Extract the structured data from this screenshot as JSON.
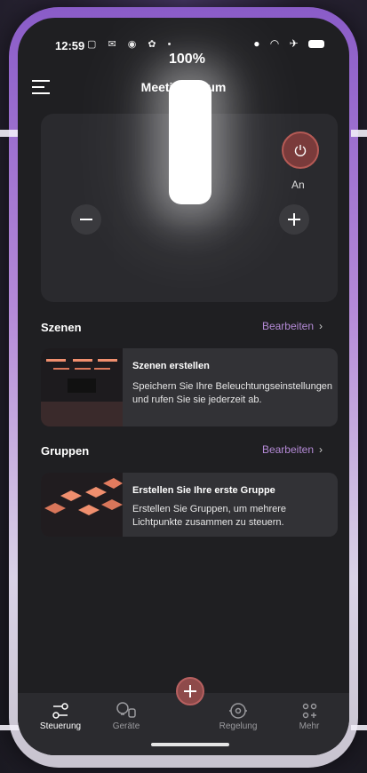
{
  "status_bar": {
    "time": "12:59"
  },
  "header": {
    "title": "Meeting Raum",
    "menu_icon": "menu-icon"
  },
  "control": {
    "brightness": "100%",
    "brightness_value": 100,
    "power_state": "An",
    "accent": "#b55a55"
  },
  "scenes": {
    "title": "Szenen",
    "edit_label": "Bearbeiten",
    "card": {
      "title": "Szenen erstellen",
      "description": "Speichern Sie Ihre Beleuchtungseinstellungen und rufen Sie sie jederzeit ab."
    }
  },
  "groups": {
    "title": "Gruppen",
    "edit_label": "Bearbeiten",
    "card": {
      "title": "Erstellen Sie Ihre erste Gruppe",
      "description": "Erstellen Sie Gruppen, um mehrere Lichtpunkte zusammen zu steuern."
    }
  },
  "nav": {
    "items": [
      {
        "label": "Steuerung",
        "icon": "control-icon",
        "active": true
      },
      {
        "label": "Geräte",
        "icon": "devices-icon",
        "active": false
      },
      {
        "label": "Regelung",
        "icon": "regulation-icon",
        "active": false
      },
      {
        "label": "Mehr",
        "icon": "more-icon",
        "active": false
      }
    ],
    "add_icon": "plus-icon"
  },
  "colors": {
    "link": "#b48ad6",
    "fab": "#8e4a4a",
    "background": "#1f1f22"
  }
}
